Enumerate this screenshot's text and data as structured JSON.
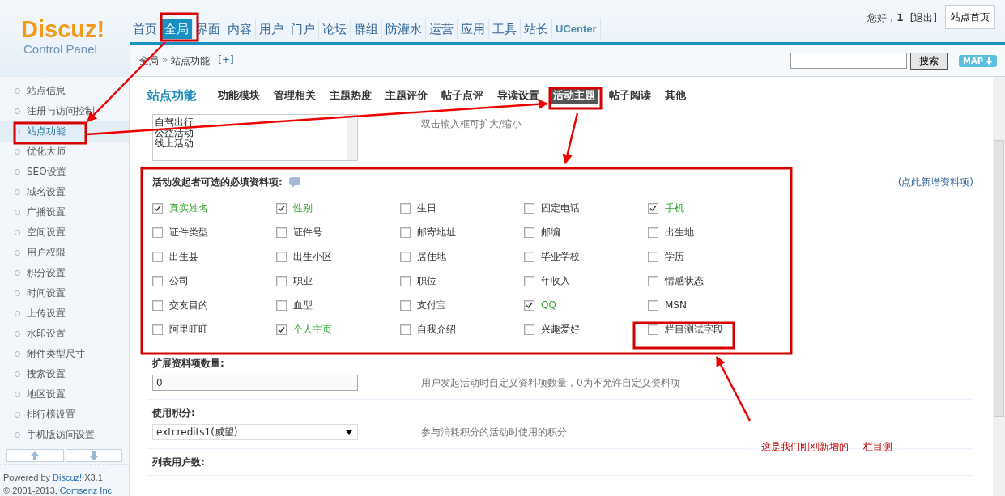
{
  "logo": {
    "title": "Discuz!",
    "subtitle": "Control Panel"
  },
  "nav": [
    {
      "label": "首页",
      "selected": false
    },
    {
      "label": "全局",
      "selected": true
    },
    {
      "label": "界面",
      "selected": false
    },
    {
      "label": "内容",
      "selected": false
    },
    {
      "label": "用户",
      "selected": false
    },
    {
      "label": "门户",
      "selected": false
    },
    {
      "label": "论坛",
      "selected": false
    },
    {
      "label": "群组",
      "selected": false
    },
    {
      "label": "防灌水",
      "selected": false
    },
    {
      "label": "运营",
      "selected": false
    },
    {
      "label": "应用",
      "selected": false
    },
    {
      "label": "工具",
      "selected": false
    },
    {
      "label": "站长",
      "selected": false
    },
    {
      "label": "UCenter",
      "selected": false
    }
  ],
  "user": {
    "greeting": "您好，",
    "name": "1",
    "logout": "[退出]",
    "home_button": "站点首页"
  },
  "breadcrumb": {
    "root": "全局",
    "separator": "»",
    "current": "站点功能",
    "add": "[+]"
  },
  "search": {
    "button": "搜索"
  },
  "map_button": "MAP",
  "sidebar": {
    "items": [
      {
        "label": "站点信息",
        "selected": false
      },
      {
        "label": "注册与访问控制",
        "selected": false
      },
      {
        "label": "站点功能",
        "selected": true
      },
      {
        "label": "优化大师",
        "selected": false
      },
      {
        "label": "SEO设置",
        "selected": false
      },
      {
        "label": "域名设置",
        "selected": false
      },
      {
        "label": "广播设置",
        "selected": false
      },
      {
        "label": "空间设置",
        "selected": false
      },
      {
        "label": "用户权限",
        "selected": false
      },
      {
        "label": "积分设置",
        "selected": false
      },
      {
        "label": "时间设置",
        "selected": false
      },
      {
        "label": "上传设置",
        "selected": false
      },
      {
        "label": "水印设置",
        "selected": false
      },
      {
        "label": "附件类型尺寸",
        "selected": false
      },
      {
        "label": "搜索设置",
        "selected": false
      },
      {
        "label": "地区设置",
        "selected": false
      },
      {
        "label": "排行榜设置",
        "selected": false
      },
      {
        "label": "手机版访问设置",
        "selected": false
      }
    ],
    "footer": {
      "powered": "Powered by",
      "product": "Discuz!",
      "version": "X3.1",
      "copyright": "© 2001-2013,",
      "company": "Comsenz Inc."
    }
  },
  "section": {
    "title": "站点功能",
    "tabs": [
      {
        "label": "功能模块",
        "selected": false
      },
      {
        "label": "管理相关",
        "selected": false
      },
      {
        "label": "主题热度",
        "selected": false
      },
      {
        "label": "主题评价",
        "selected": false
      },
      {
        "label": "帖子点评",
        "selected": false
      },
      {
        "label": "导读设置",
        "selected": false
      },
      {
        "label": "活动主题",
        "selected": true
      },
      {
        "label": "帖子阅读",
        "selected": false
      },
      {
        "label": "其他",
        "selected": false
      }
    ]
  },
  "textarea": {
    "lines": [
      "自驾出行",
      "公益活动",
      "线上活动"
    ],
    "hint": "双击输入框可扩大/缩小"
  },
  "required_fields": {
    "label": "活动发起者可选的必填资料项:",
    "add_link": "(点此新增资料项)",
    "options": [
      {
        "label": "真实姓名",
        "checked": true
      },
      {
        "label": "性别",
        "checked": true
      },
      {
        "label": "生日",
        "checked": false
      },
      {
        "label": "固定电话",
        "checked": false
      },
      {
        "label": "手机",
        "checked": true
      },
      {
        "label": "证件类型",
        "checked": false
      },
      {
        "label": "证件号",
        "checked": false
      },
      {
        "label": "邮寄地址",
        "checked": false
      },
      {
        "label": "邮编",
        "checked": false
      },
      {
        "label": "出生地",
        "checked": false
      },
      {
        "label": "出生县",
        "checked": false
      },
      {
        "label": "出生小区",
        "checked": false
      },
      {
        "label": "居住地",
        "checked": false
      },
      {
        "label": "毕业学校",
        "checked": false
      },
      {
        "label": "学历",
        "checked": false
      },
      {
        "label": "公司",
        "checked": false
      },
      {
        "label": "职业",
        "checked": false
      },
      {
        "label": "职位",
        "checked": false
      },
      {
        "label": "年收入",
        "checked": false
      },
      {
        "label": "情感状态",
        "checked": false
      },
      {
        "label": "交友目的",
        "checked": false
      },
      {
        "label": "血型",
        "checked": false
      },
      {
        "label": "支付宝",
        "checked": false
      },
      {
        "label": "QQ",
        "checked": true
      },
      {
        "label": "MSN",
        "checked": false
      },
      {
        "label": "阿里旺旺",
        "checked": false
      },
      {
        "label": "个人主页",
        "checked": true
      },
      {
        "label": "自我介绍",
        "checked": false
      },
      {
        "label": "兴趣爱好",
        "checked": false
      },
      {
        "label": "栏目测试字段",
        "checked": false
      }
    ]
  },
  "settings": [
    {
      "label": "扩展资料项数量:",
      "kind": "input",
      "value": "0",
      "hint": "用户发起活动时自定义资料项数量，0为不允许自定义资料项"
    },
    {
      "label": "使用积分:",
      "kind": "select",
      "value": "extcredits1(威望)",
      "hint": "参与消耗积分的活动时使用的积分"
    },
    {
      "label": "列表用户数:",
      "kind": "none"
    }
  ],
  "annotation": {
    "parts": [
      "这是我们刚刚新增的",
      "栏目测"
    ]
  }
}
